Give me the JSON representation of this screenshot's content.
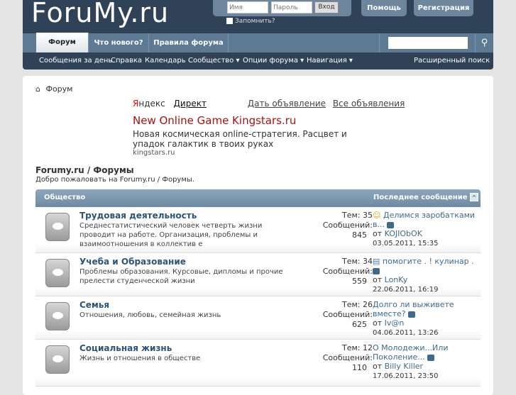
{
  "header": {
    "logo": "ForuMy.ru",
    "username_placeholder": "Имя",
    "password_placeholder": "Пароль",
    "login_button": "Вход",
    "remember": "Запомнить?",
    "help": "Помощь",
    "register": "Регистрация"
  },
  "tabs": [
    "Форум",
    "Что нового?",
    "Правила форума"
  ],
  "subnav": [
    "Сообщения за день",
    "Справка",
    "Календарь",
    "Сообщество ▾",
    "Опции форума ▾",
    "Навигация ▾"
  ],
  "advanced_search": "Расширенный поиск",
  "breadcrumb": "Форум",
  "ad": {
    "yandex_y": "Я",
    "yandex_rest": "ндекс",
    "direct": "Директ",
    "give_ad": "Дать объявление",
    "all_ads": "Все объявления",
    "title": "New Online Game Kingstars.ru",
    "text": "Новая космическая online-стратегия. Расцвет и упадок галактик в твоих руках",
    "domain": "kingstars.ru"
  },
  "page": {
    "title": "Forumy.ru / Форумы",
    "welcome": "Добро пожаловать на Forumy.ru / Форумы."
  },
  "category": {
    "name": "Общество",
    "last_post": "Последнее сообщение"
  },
  "forums": [
    {
      "name": "Трудовая деятельность",
      "desc": "Среднестатистический человек четверть жизни проводит на работе. Организация, проблемы и взаимоотношения в коллектив е",
      "threads": "Тем: 35",
      "posts_label": "Сообщений:",
      "posts": "845",
      "last_title": "Делимся заробатками в...",
      "by": "от",
      "user": "KOJIObOK",
      "date": "03.05.2011, 15:35"
    },
    {
      "name": "Учеба и Образование",
      "desc": "Проблемы образования. Курсовые, дипломы и прочие прелести студенческой жизни",
      "threads": "Тем: 34",
      "posts_label": "Сообщений:",
      "posts": "559",
      "last_title": "помогите . ! кулинар .",
      "by": "от",
      "user": "LonKy",
      "date": "22.06.2011, 16:19"
    },
    {
      "name": "Семья",
      "desc": "Отношения, любовь, семейная жизнь",
      "threads": "Тем: 26",
      "posts_label": "Сообщений:",
      "posts": "625",
      "last_title": "Долго ли выживете вместе?",
      "by": "от",
      "user": "Iv@n",
      "date": "04.06.2011, 13:26"
    },
    {
      "name": "Социальная жизнь",
      "desc": "Жизнь и отношения в обществе",
      "threads": "Тем: 12",
      "posts_label": "Сообщений:",
      "posts": "110",
      "last_title": "О Молодежи...Или Поколение...",
      "by": "от",
      "user": "Billy Killer",
      "date": "17.06.2011, 23:50"
    }
  ]
}
